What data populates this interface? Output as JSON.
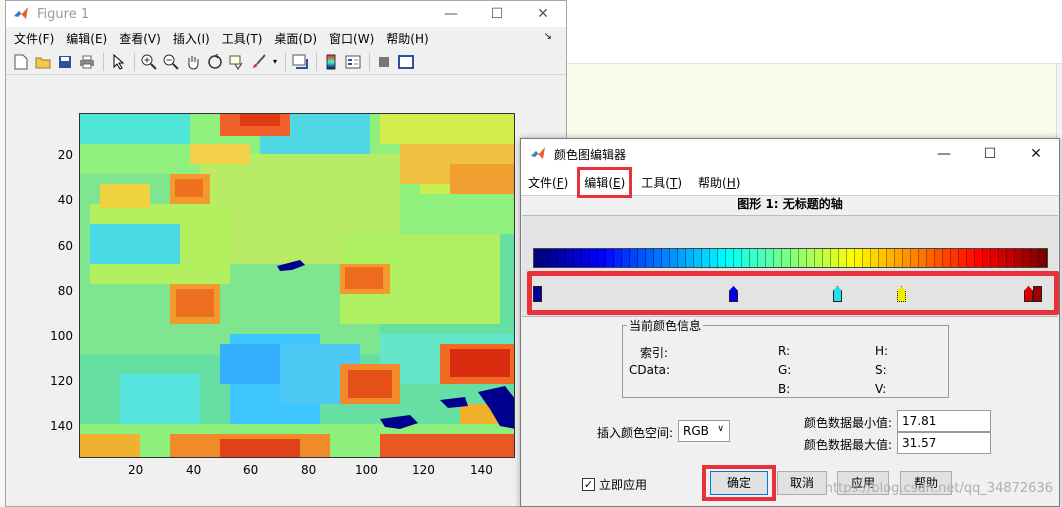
{
  "figure": {
    "title": "Figure 1",
    "menu": [
      "文件(F)",
      "编辑(E)",
      "查看(V)",
      "插入(I)",
      "工具(T)",
      "桌面(D)",
      "窗口(W)",
      "帮助(H)"
    ],
    "toolbar_icons": [
      "new-file-icon",
      "open-folder-icon",
      "save-icon",
      "print-icon",
      "pointer-icon",
      "zoom-in-icon",
      "zoom-out-icon",
      "pan-hand-icon",
      "rotate-3d-icon",
      "data-cursor-icon",
      "brush-icon",
      "link-plot-icon",
      "colorbar-icon",
      "legend-icon",
      "hide-plot-tools-icon",
      "show-plot-tools-icon"
    ],
    "y_ticks": [
      "20",
      "40",
      "60",
      "80",
      "100",
      "120",
      "140"
    ],
    "x_ticks": [
      "20",
      "40",
      "60",
      "80",
      "100",
      "120",
      "140"
    ]
  },
  "editor": {
    "title": "颜色图编辑器",
    "menu": [
      {
        "label": "文件",
        "key": "F"
      },
      {
        "label": "编辑",
        "key": "E"
      },
      {
        "label": "工具",
        "key": "T"
      },
      {
        "label": "帮助",
        "key": "H"
      }
    ],
    "subtitle": "图形 1: 无标题的轴",
    "info": {
      "legend": "当前颜色信息",
      "index_label": "索引:",
      "cdata_label": "CData:",
      "r_label": "R:",
      "g_label": "G:",
      "b_label": "B:",
      "h_label": "H:",
      "s_label": "S:",
      "v_label": "V:"
    },
    "interp_label": "插入颜色空间:",
    "interp_value": "RGB",
    "min_label": "颜色数据最小值:",
    "min_value": "17.81",
    "max_label": "颜色数据最大值:",
    "max_value": "31.57",
    "apply_now_label": "立即应用",
    "apply_now_checked": "✓",
    "buttons": {
      "ok": "确定",
      "cancel": "取消",
      "apply": "应用",
      "help": "帮助"
    }
  },
  "watermark": "https://blog.csdn.net/qq_34872636",
  "colors": {
    "highlight": "#e8313b",
    "marker_blue1": "#0000a0",
    "marker_blue2": "#0000e0",
    "marker_cyan": "#20e0f0",
    "marker_yellow": "#f0f000",
    "marker_red": "#e00000"
  }
}
